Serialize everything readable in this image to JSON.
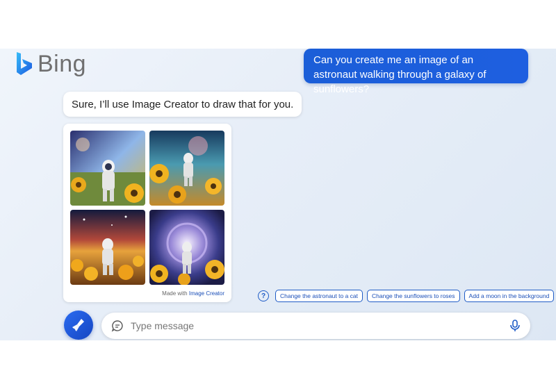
{
  "brand": {
    "name": "Bing"
  },
  "conversation": {
    "user_message": "Can you create me an image of an astronaut walking through a galaxy of sunflowers?",
    "bot_message": "Sure, I’ll use Image Creator to draw that for you.",
    "image_card": {
      "images": [
        {
          "icon": "astronaut-sunflowers-image-1"
        },
        {
          "icon": "astronaut-sunflowers-image-2"
        },
        {
          "icon": "astronaut-sunflowers-image-3"
        },
        {
          "icon": "astronaut-sunflowers-image-4"
        }
      ],
      "footer_prefix": "Made with",
      "footer_link": "Image Creator"
    }
  },
  "suggestions": {
    "chips": [
      "Change the astronaut to a cat",
      "Change the sunflowers to roses",
      "Add a moon in the background"
    ]
  },
  "composer": {
    "placeholder": "Type message"
  },
  "colors": {
    "accent": "#1e5fe0",
    "chip_text": "#1b4fb8"
  }
}
